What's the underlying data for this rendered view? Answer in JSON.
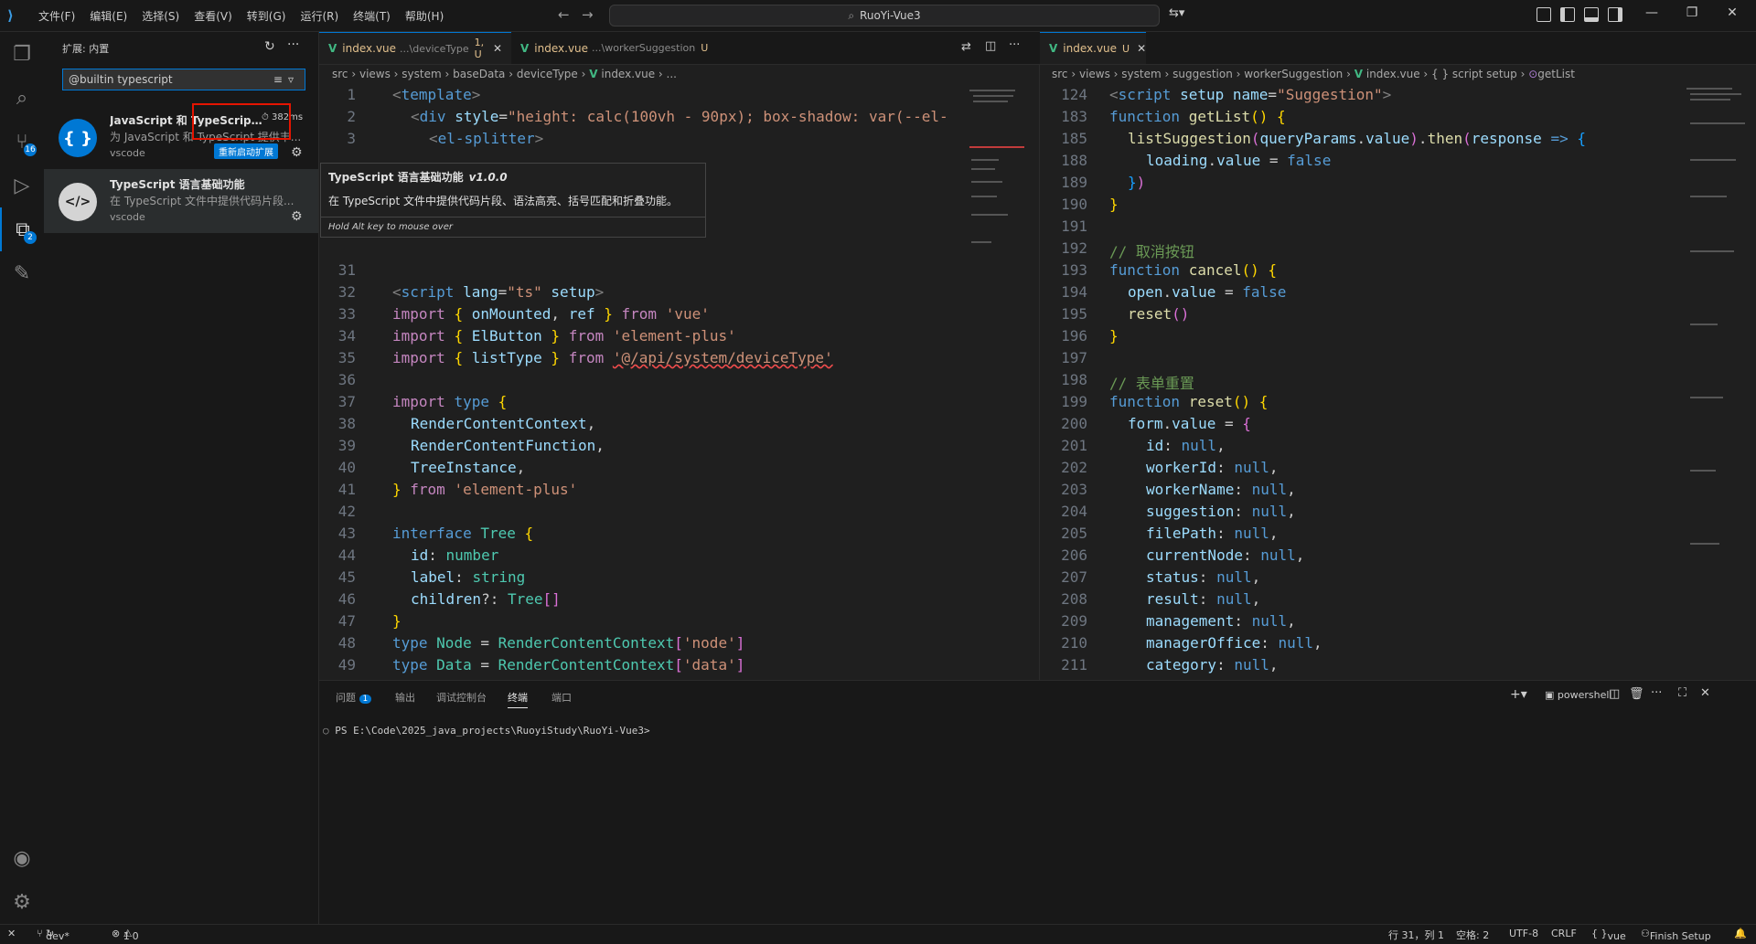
{
  "titlebar": {
    "menus": [
      "文件(F)",
      "编辑(E)",
      "选择(S)",
      "查看(V)",
      "转到(G)",
      "运行(R)",
      "终端(T)",
      "帮助(H)"
    ],
    "search": "RuoYi-Vue3"
  },
  "activity": {
    "scm_badge": "16",
    "ext_badge": "2"
  },
  "sidebar": {
    "title": "扩展: 内置",
    "search_value": "@builtin typescript",
    "extensions": [
      {
        "name": "JavaScript 和 TypeScript...",
        "desc": "为 JavaScript 和 TypeScript 提供丰...",
        "publisher": "vscode",
        "time": "382ms",
        "action": "重新启动扩展"
      },
      {
        "name": "TypeScript 语言基础功能",
        "desc": "在 TypeScript 文件中提供代码片段...",
        "publisher": "vscode"
      }
    ]
  },
  "hover": {
    "title": "TypeScript 语言基础功能",
    "version": "v1.0.0",
    "desc": "在 TypeScript 文件中提供代码片段、语法高亮、括号匹配和折叠功能。",
    "hint": "Hold Alt key to mouse over"
  },
  "editor_left": {
    "tabs": [
      {
        "name": "index.vue",
        "dir": "...\\deviceType",
        "status": "1, U"
      },
      {
        "name": "index.vue",
        "dir": "...\\workerSuggestion",
        "status": "U"
      }
    ],
    "breadcrumb": [
      "src",
      "views",
      "system",
      "baseData",
      "deviceType",
      "index.vue",
      "..."
    ]
  },
  "editor_right": {
    "tabs": [
      {
        "name": "index.vue",
        "status": "U"
      }
    ],
    "breadcrumb": [
      "src",
      "views",
      "system",
      "suggestion",
      "workerSuggestion",
      "index.vue",
      "{ } script setup",
      "getList"
    ]
  },
  "panel": {
    "tabs": [
      "问题",
      "输出",
      "调试控制台",
      "终端",
      "端口"
    ],
    "problems_badge": "1",
    "shell": "powershell",
    "prompt": "PS E:\\Code\\2025_java_projects\\RuoyiStudy\\RuoYi-Vue3>"
  },
  "statusbar": {
    "branch": "dev*",
    "errors": "1",
    "warnings": "0",
    "position": "行 31，列 1",
    "spaces": "空格: 2",
    "encoding": "UTF-8",
    "eol": "CRLF",
    "language": "vue",
    "setup": "Finish Setup"
  }
}
